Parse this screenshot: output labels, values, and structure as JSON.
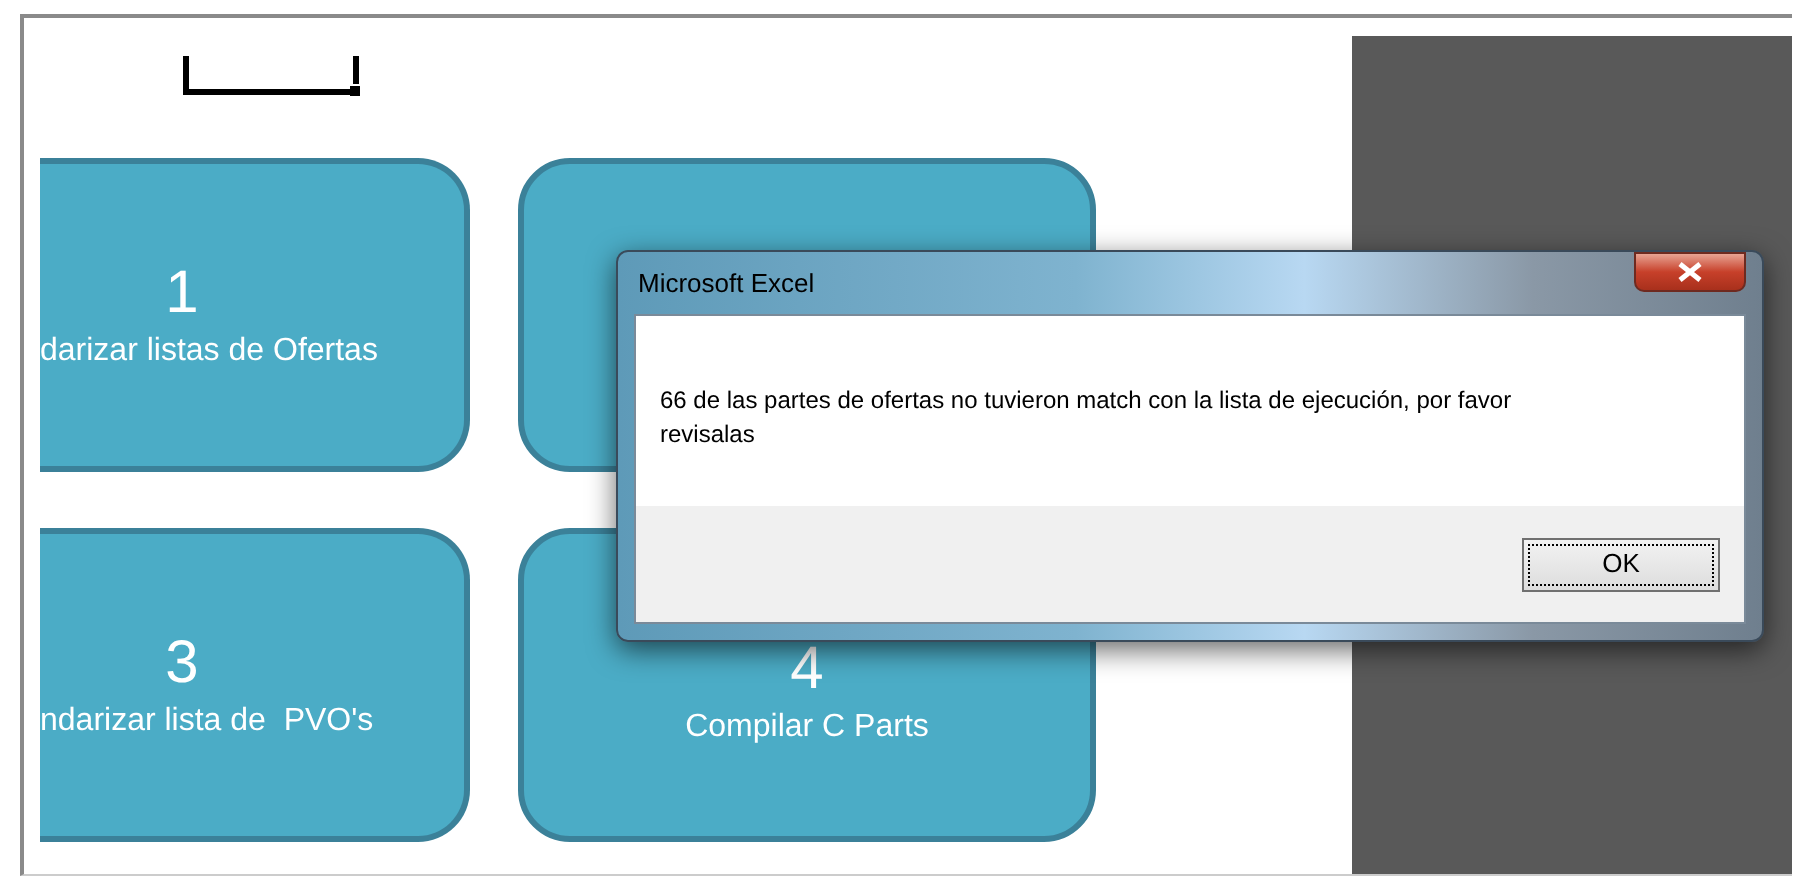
{
  "cards": [
    {
      "number": "1",
      "label": "darizar listas de Ofertas"
    },
    {
      "number": "3",
      "label": "ndarizar lista de  PVO's"
    },
    {
      "number": "4",
      "label": "Compilar C Parts"
    }
  ],
  "dialog": {
    "title": "Microsoft Excel",
    "message": "66 de las partes de ofertas no tuvieron match con la lista de ejecución, por favor revisalas",
    "buttons": [
      "OK"
    ]
  }
}
